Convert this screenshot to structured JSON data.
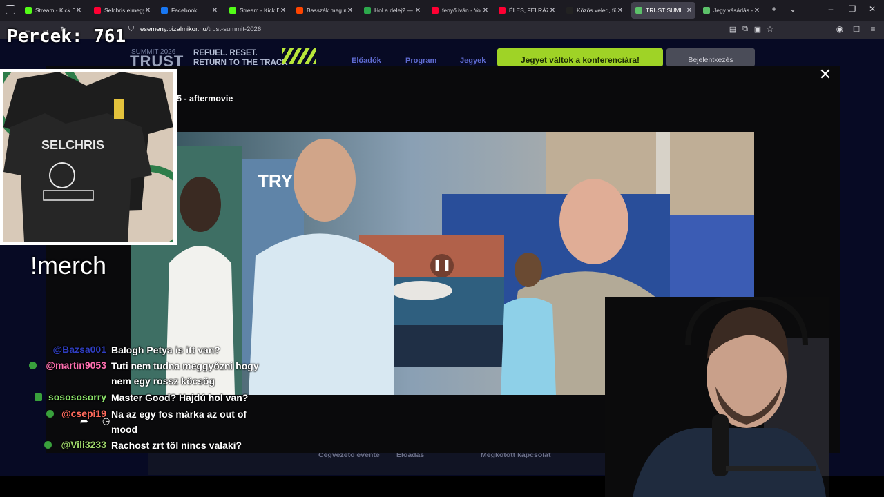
{
  "browser": {
    "tabs": [
      {
        "label": "Stream - Kick Da",
        "color": "#53fc18"
      },
      {
        "label": "Selchris elmegy",
        "color": "#ff0033"
      },
      {
        "label": "Facebook",
        "color": "#1877f2"
      },
      {
        "label": "Stream - Kick Da",
        "color": "#53fc18"
      },
      {
        "label": "Basszák meg ma",
        "color": "#ff4500"
      },
      {
        "label": "Hol a delej? — él",
        "color": "#2ca84c"
      },
      {
        "label": "fenyő iván - You",
        "color": "#ff0033"
      },
      {
        "label": "ÉLES, FELRÁZÓ, É",
        "color": "#ff0033"
      },
      {
        "label": "Közös veled, fügi",
        "color": "#222222"
      },
      {
        "label": "TRUST SUMI",
        "color": "#5cc16a"
      },
      {
        "label": "Jegy vásárlás - Tr",
        "color": "#5cc16a"
      }
    ],
    "url_domain": "esemeny.bizalmikor.hu",
    "url_path": "/trust-summit-2026"
  },
  "site": {
    "logo_small": "SUMMIT 2026",
    "logo_big": "TRUST",
    "slogan_line1": "REFUEL. RESET.",
    "slogan_line2": "RETURN TO THE TRACK",
    "nav": [
      "Előadók",
      "Program",
      "Jegyek"
    ],
    "buy_button": "Jegyet váltok a konferenciára!",
    "signin_button": "Bejelentkezés",
    "footer_links": [
      "Cégvezető évente",
      "Előadás",
      "Megkötött kapcsolat"
    ]
  },
  "modal": {
    "title": "5 - aftermovie",
    "close_symbol": "✕"
  },
  "video": {
    "pause_symbol": "❚❚",
    "sign_text": "TRY WIT"
  },
  "overlay": {
    "timer": "Percek: 761",
    "merch_command": "!merch",
    "shirt_print": "SELCHRIS"
  },
  "chat": [
    {
      "user": "@Bazsa001",
      "user_color": "#2f3ec0",
      "message": "Balogh Petya is itt van?",
      "badge": false
    },
    {
      "user": "@martin9053",
      "user_color": "#ff6fb0",
      "message": "Tuti nem tudna meggyőzni hogy nem egy rossz köcsög",
      "badge": true
    },
    {
      "user": "sosososorry",
      "user_color": "#8be36a",
      "message": "Master Good? Hajdú hol van?",
      "badge": true
    },
    {
      "user": "@csepi19",
      "user_color": "#ff6a5c",
      "message": "Na az egy fos márka az out of mood",
      "badge": true
    },
    {
      "user": "@Vili3233",
      "user_color": "#9fd86b",
      "message": "Rachost zrt től nincs valaki?",
      "badge": true
    }
  ]
}
